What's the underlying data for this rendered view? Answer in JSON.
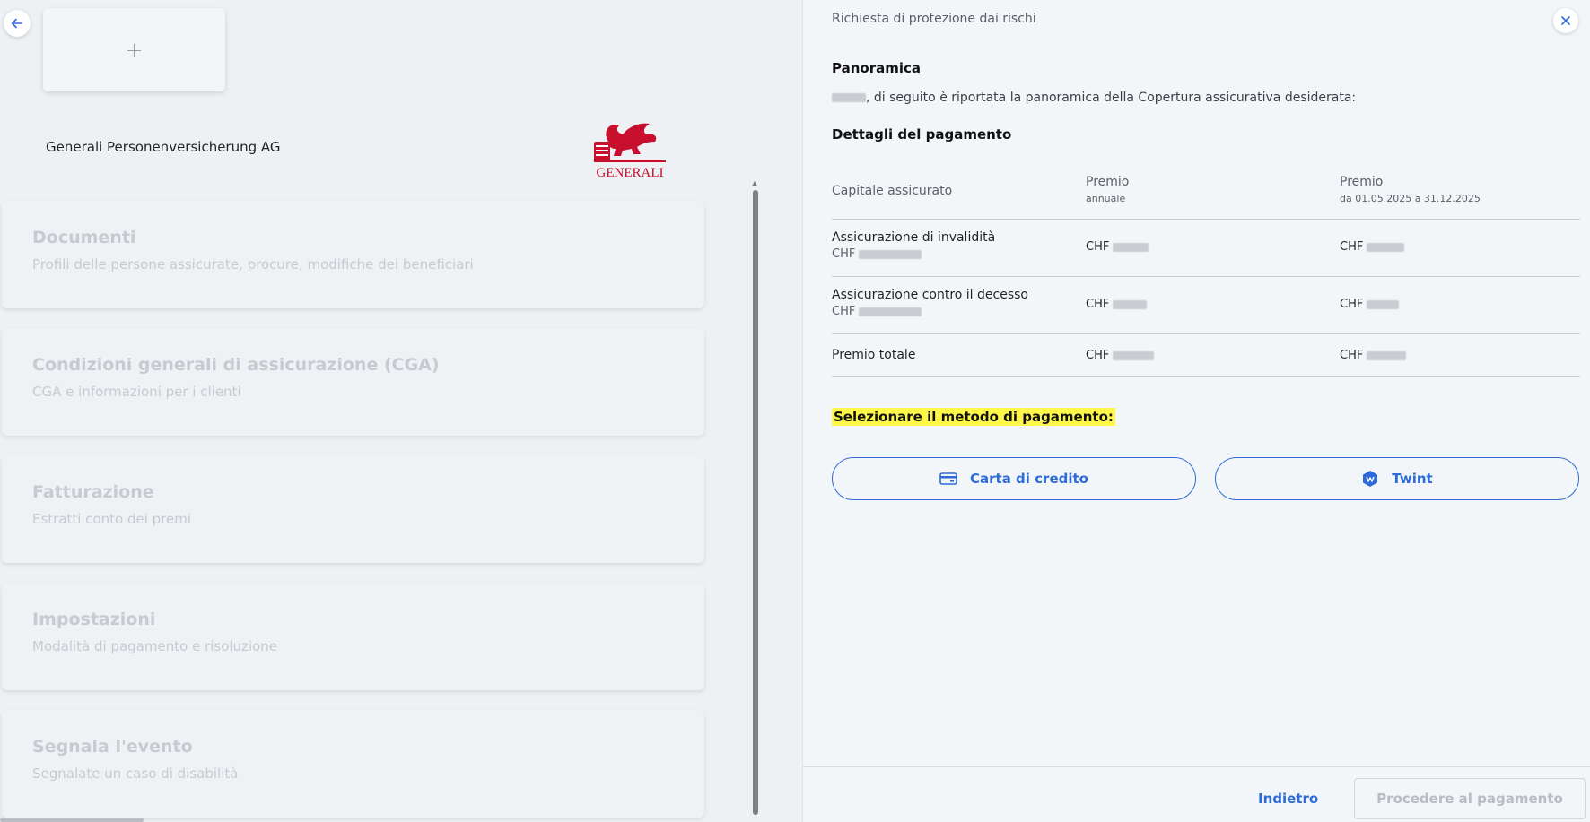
{
  "left": {
    "company_name": "Generali Personenversicherung AG",
    "logo_text": "GENERALI",
    "add_label": "+",
    "menu": [
      {
        "title": "Documenti",
        "subtitle": "Profili delle persone assicurate, procure, modifiche dei beneficiari"
      },
      {
        "title": "Condizioni generali di assicurazione (CGA)",
        "subtitle": "CGA e informazioni per i clienti"
      },
      {
        "title": "Fatturazione",
        "subtitle": "Estratti conto dei premi"
      },
      {
        "title": "Impostazioni",
        "subtitle": "Modalità di pagamento e risoluzione"
      },
      {
        "title": "Segnala l'evento",
        "subtitle": "Segnalate un caso di disabilità"
      }
    ]
  },
  "panel": {
    "header": "Richiesta di protezione dai rischi",
    "overview_title": "Panoramica",
    "intro_text": ", di seguito è riportata la panoramica della Copertura assicurativa desiderata:",
    "payment_details_title": "Dettagli del pagamento",
    "table": {
      "col1": "Capitale assicurato",
      "col2": "Premio",
      "col2_sub": "annuale",
      "col3": "Premio",
      "col3_sub": "da 01.05.2025 a 31.12.2025",
      "rows": [
        {
          "name": "Assicurazione di invalidità",
          "capital": "CHF",
          "annual": "CHF",
          "period": "CHF"
        },
        {
          "name": "Assicurazione contro il decesso",
          "capital": "CHF",
          "annual": "CHF",
          "period": "CHF"
        },
        {
          "name": "Premio totale",
          "annual": "CHF",
          "period": "CHF"
        }
      ]
    },
    "select_payment": "Selezionare il metodo di pagamento:",
    "credit_card": "Carta di credito",
    "twint": "Twint",
    "back": "Indietro",
    "proceed": "Procedere al pagamento"
  },
  "colors": {
    "accent": "#2e6bd8",
    "highlight": "#fff84a",
    "brand": "#c8102e"
  }
}
